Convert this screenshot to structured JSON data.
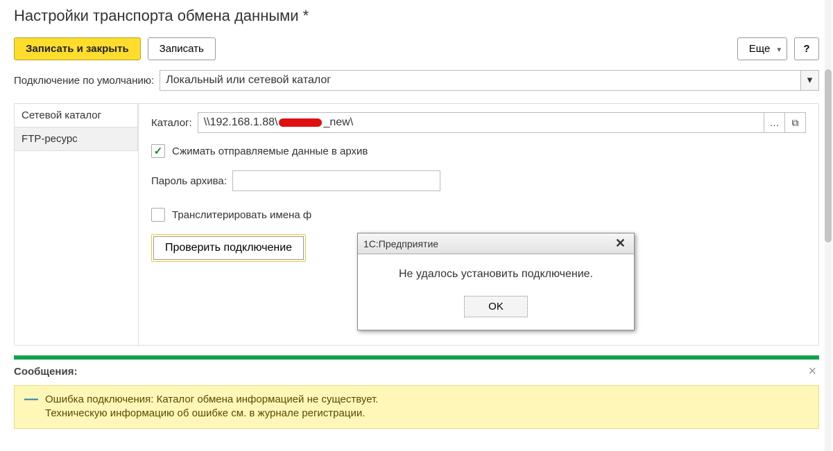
{
  "title": "Настройки транспорта обмена данными *",
  "toolbar": {
    "save_close": "Записать и закрыть",
    "save": "Записать",
    "more": "Еще",
    "help": "?"
  },
  "default_conn": {
    "label": "Подключение по умолчанию:",
    "value": "Локальный или сетевой каталог"
  },
  "tabs": {
    "net": "Сетевой каталог",
    "ftp": "FTP-ресурс"
  },
  "catalog": {
    "label": "Каталог:",
    "value_prefix": "\\\\192.168.1.88\\",
    "value_suffix": "_new\\"
  },
  "compress": {
    "checked": true,
    "label": "Сжимать отправляемые данные в архив"
  },
  "archive_pw_label": "Пароль архива:",
  "translit": {
    "checked": false,
    "label": "Транслитерировать имена ф"
  },
  "test_btn": "Проверить подключение",
  "modal": {
    "title": "1С:Предприятие",
    "message": "Не удалось установить подключение.",
    "ok": "OK"
  },
  "messages": {
    "heading": "Сообщения:",
    "error_l1": "Ошибка подключения: Каталог обмена информацией не существует.",
    "error_l2": "Техническую информацию об ошибке см. в журнале регистрации."
  }
}
